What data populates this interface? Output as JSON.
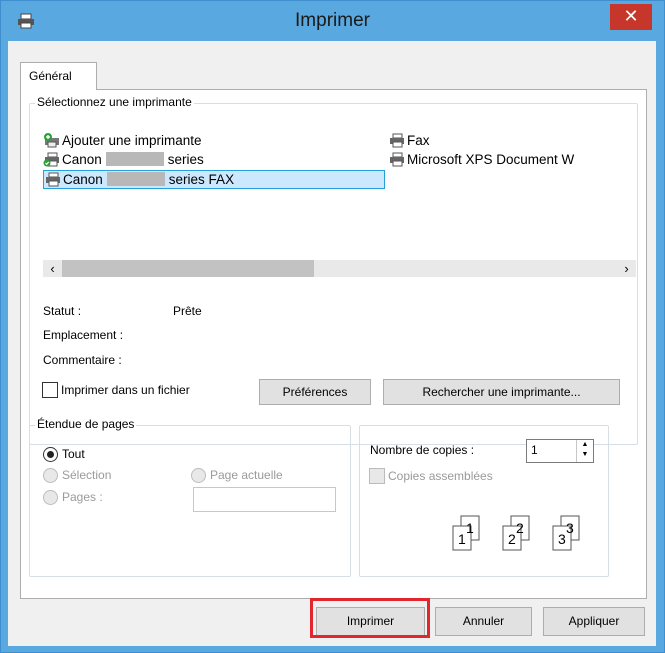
{
  "window": {
    "title": "Imprimer",
    "close_glyph": "✕"
  },
  "tabs": [
    {
      "label": "Général"
    }
  ],
  "printer_group": {
    "legend": "Sélectionnez une imprimante",
    "printers": [
      {
        "name_prefix": "Ajouter une imprimante",
        "name_suffix": "",
        "icon": "add-printer-icon",
        "selected": false
      },
      {
        "name_prefix": "Canon",
        "name_suffix": "series",
        "icon": "default-printer-icon",
        "selected": false
      },
      {
        "name_prefix": "Canon",
        "name_suffix": "series FAX",
        "icon": "fax-printer-icon",
        "selected": true
      },
      {
        "name_prefix": "Fax",
        "name_suffix": "",
        "icon": "printer-icon",
        "selected": false
      },
      {
        "name_prefix": "Microsoft XPS Document W",
        "name_suffix": "",
        "icon": "printer-icon",
        "selected": false
      }
    ]
  },
  "status": {
    "statut_label": "Statut :",
    "statut_value": "Prête",
    "emplacement_label": "Emplacement :",
    "commentaire_label": "Commentaire :"
  },
  "print_to_file_label": "Imprimer dans un fichier",
  "preferences_button": "Préférences",
  "find_printer_button": "Rechercher une imprimante...",
  "page_range": {
    "legend": "Étendue de pages",
    "all_label": "Tout",
    "selection_label": "Sélection",
    "current_page_label": "Page actuelle",
    "pages_label": "Pages :",
    "pages_value": ""
  },
  "copies": {
    "label": "Nombre de copies :",
    "value": "1",
    "collate_label": "Copies assemblées",
    "collate_pages": [
      "1",
      "1",
      "2",
      "2",
      "3",
      "3"
    ]
  },
  "buttons": {
    "print": "Imprimer",
    "cancel": "Annuler",
    "apply": "Appliquer"
  },
  "colors": {
    "titlebar": "#5aa8e0",
    "close": "#c7362a",
    "selection": "#cce8ff",
    "highlight": "#e1262d"
  }
}
